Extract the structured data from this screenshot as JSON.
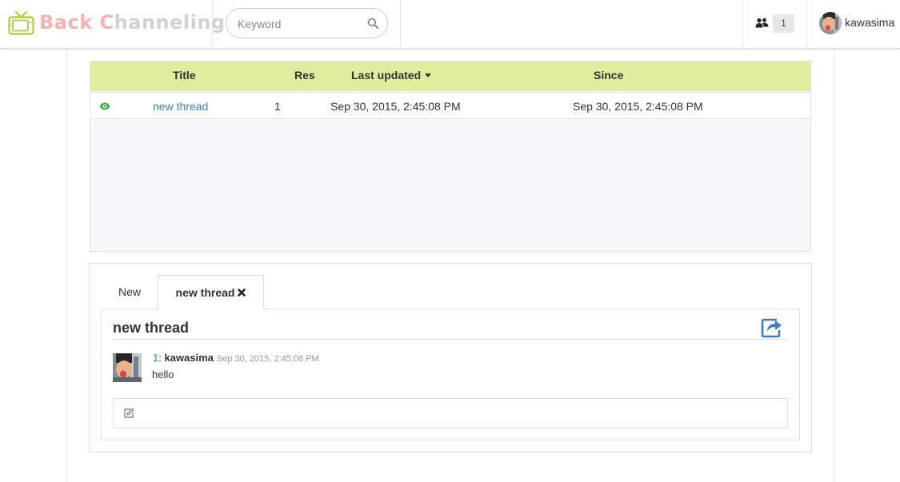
{
  "app": {
    "brand_part1": "Back ",
    "brand_part2": "C",
    "brand_part3": "hanneling",
    "brand_colors": {
      "pink": "#f3b3b3",
      "gray": "#d2d2d2",
      "tv_green": "#a6cf3a"
    }
  },
  "search": {
    "placeholder": "Keyword",
    "value": "",
    "icon": "search-icon"
  },
  "users": {
    "icon": "users-icon",
    "count": "1"
  },
  "user": {
    "name": "kawasima",
    "icon": "avatar"
  },
  "thread_table": {
    "headers": {
      "title": "Title",
      "res": "Res",
      "last_updated": "Last updated",
      "since": "Since"
    },
    "sort_column": "last_updated",
    "sort_direction": "desc",
    "rows": [
      {
        "watched_icon": "eye-icon",
        "title": "new thread",
        "res": "1",
        "last_updated": "Sep 30, 2015, 2:45:08 PM",
        "since": "Sep 30, 2015, 2:45:08 PM"
      }
    ]
  },
  "detail": {
    "tabs": [
      {
        "label": "New",
        "active": false
      },
      {
        "label": "new thread",
        "active": true,
        "closable": true
      }
    ],
    "thread_title": "new thread",
    "share_icon": "share-icon",
    "posts": [
      {
        "number": "1",
        "separator": ": ",
        "author": "kawasima",
        "timestamp": "Sep 30, 2015, 2:45:08 PM",
        "body": "hello"
      }
    ],
    "reply_icon": "edit-icon"
  },
  "colors": {
    "header_row": "#dfee9e",
    "link": "#3a7fbf",
    "eye": "#3db24a",
    "share": "#3a7fbf"
  }
}
